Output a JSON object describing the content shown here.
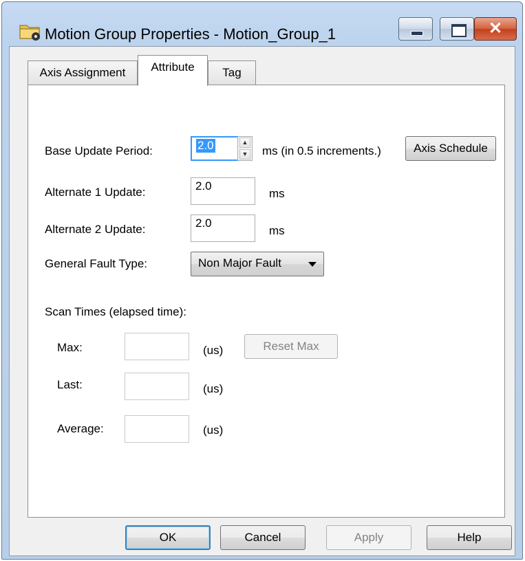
{
  "window": {
    "title": "Motion Group Properties - Motion_Group_1",
    "icons": {
      "app": "folder-gear-icon",
      "minimize": "minimize-icon",
      "maximize": "maximize-icon",
      "close": "close-icon"
    }
  },
  "tabs": [
    {
      "label": "Axis Assignment",
      "selected": false
    },
    {
      "label": "Attribute",
      "selected": true
    },
    {
      "label": "Tag",
      "selected": false
    }
  ],
  "attribute": {
    "base_update_period": {
      "label": "Base Update Period:",
      "value": "2.0",
      "unit_note": "ms (in 0.5 increments.)"
    },
    "axis_schedule_button": "Axis Schedule",
    "alternate1": {
      "label": "Alternate 1 Update:",
      "value": "2.0",
      "unit": "ms"
    },
    "alternate2": {
      "label": "Alternate 2 Update:",
      "value": "2.0",
      "unit": "ms"
    },
    "general_fault_type": {
      "label": "General Fault Type:",
      "selected": "Non Major Fault"
    },
    "scan_times": {
      "heading": "Scan Times (elapsed time):",
      "max": {
        "label": "Max:",
        "value": "",
        "unit": "(us)"
      },
      "last": {
        "label": "Last:",
        "value": "",
        "unit": "(us)"
      },
      "average": {
        "label": "Average:",
        "value": "",
        "unit": "(us)"
      },
      "reset_max_button": "Reset Max"
    }
  },
  "buttons": {
    "ok": "OK",
    "cancel": "Cancel",
    "apply": "Apply",
    "help": "Help"
  },
  "colors": {
    "accent": "#3399ff",
    "disabled_text": "#838383"
  }
}
